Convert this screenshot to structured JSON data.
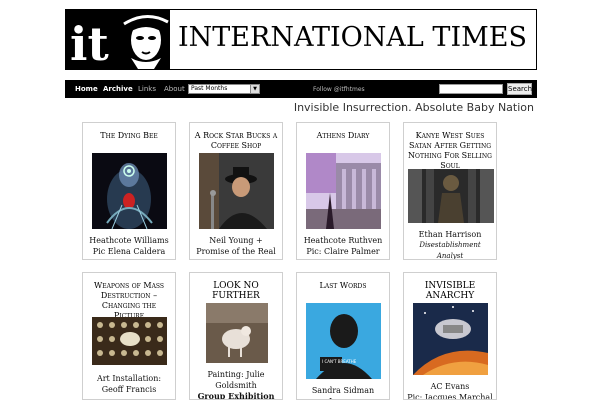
{
  "site": {
    "title": "INTERNATIONAL TIMES",
    "logo_text": "it",
    "tagline": "Invisible Insurrection. Absolute Baby Nation"
  },
  "nav": {
    "items": [
      "Home",
      "Archive",
      "Links",
      "About"
    ],
    "select_value": "Past Months",
    "follow": "Follow @itfhtmes",
    "search_label": "Search"
  },
  "articles": [
    {
      "title": "The Dying Bee",
      "line1": "Heathcote Williams",
      "line2": "Pic Elena Caldera",
      "line3": ""
    },
    {
      "title": "A Rock Star Bucks a Coffee Shop",
      "line1": "Neil Young +",
      "line2": "Promise of the Real",
      "line3": ""
    },
    {
      "title": "Athens Diary",
      "line1": "Heathcote Ruthven",
      "line2": "Pic: Claire Palmer",
      "line3": ""
    },
    {
      "title": "Kanye West Sues Satan After Getting Nothing For Selling Soul",
      "line1": "Ethan Harrison",
      "line2": "Disestablishment Analyst",
      "line3": ""
    },
    {
      "title": "Weapons of Mass Destruction – Changing the Picture",
      "line1": "Art Installation:",
      "line2": "Geoff Francis",
      "line3": ""
    },
    {
      "title": "LOOK NO FURTHER",
      "line1": "Painting: Julie",
      "line2": "Goldsmith",
      "line3": "Group Exhibition"
    },
    {
      "title": "Last Words",
      "line1": "Sandra Sidman Larson",
      "line2": "",
      "line3": "",
      "poster_text": "I CAN'T BREATHE"
    },
    {
      "title": "INVISIBLE ANARCHY",
      "line1": "AC Evans",
      "line2": "Pic: Jacques Marchal",
      "line3": ""
    }
  ]
}
